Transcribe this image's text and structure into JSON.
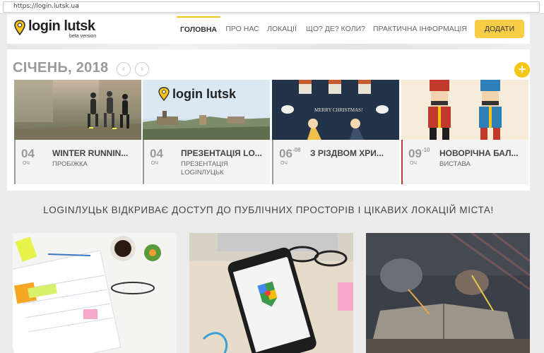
{
  "browser": {
    "url": "https://login.lutsk.ua"
  },
  "header": {
    "logo_name": "login lutsk",
    "logo_sub": "beta version",
    "nav": [
      {
        "label": "ГОЛОВНА",
        "active": true
      },
      {
        "label": "ПРО НАС",
        "active": false
      },
      {
        "label": "ЛОКАЦІЇ",
        "active": false
      },
      {
        "label": "ЩО? ДЕ? КОЛИ?",
        "active": false
      },
      {
        "label": "ПРАКТИЧНА ІНФОРМАЦІЯ",
        "active": false
      }
    ],
    "add_label": "ДОДАТИ"
  },
  "events": {
    "month": "СІЧЕНЬ, 2018",
    "prev_arrow": "‹",
    "next_arrow": "›",
    "plus": "+",
    "cards": [
      {
        "day": "04",
        "day_end": "",
        "mon": "ОЧ",
        "title": "WINTER RUNNIN...",
        "category": "ПРОБІЖКА",
        "accent": "#4a90c9",
        "image": "runners"
      },
      {
        "day": "04",
        "day_end": "",
        "mon": "ОЧ",
        "title": "ПРЕЗЕНТАЦІЯ LO...",
        "category": "ПРЕЗЕНТАЦІЯ LOGINЛУЦЬК",
        "accent": "#4a90c9",
        "image": "logo-city",
        "image_text": "login lutsk"
      },
      {
        "day": "06",
        "day_end": "-08",
        "mon": "ОЧ",
        "title": "З РІЗДВОМ ХРИ...",
        "category": "",
        "accent": "#4a90c9",
        "image": "christmas",
        "image_text": "MERRY CHRISTMAS!"
      },
      {
        "day": "09",
        "day_end": "-10",
        "mon": "ОЧ",
        "title": "НОВОРІЧНА БАЛ...",
        "category": "ВИСТАВА",
        "accent": "#c0392b",
        "image": "nutcracker"
      }
    ]
  },
  "tagline": "LOGINЛУЦЬК ВІДКРИВАЄ ДОСТУП ДО ПУБЛІЧНИХ ПРОСТОРІВ І ЦІКАВИХ ЛОКАЦІЙ МІСТА!",
  "colors": {
    "brand": "#f5c518",
    "button": "#f7cd46"
  }
}
